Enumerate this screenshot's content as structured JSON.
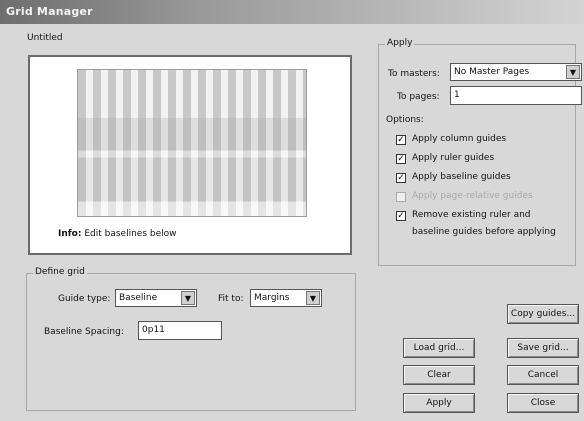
{
  "window": {
    "title": "Grid Manager"
  },
  "preview": {
    "document_label": "Untitled",
    "info_bold": "Info:",
    "info_text": " Edit baselines below"
  },
  "define_grid": {
    "group_title": "Define grid",
    "guide_type_label": "Guide type:",
    "guide_type_value": "Baseline",
    "fit_to_label": "Fit to:",
    "fit_to_value": "Margins",
    "baseline_spacing_label": "Baseline Spacing:",
    "baseline_spacing_value": "0p11"
  },
  "apply": {
    "group_title": "Apply",
    "to_masters_label": "To masters:",
    "to_masters_value": "No Master Pages",
    "to_pages_label": "To pages:",
    "to_pages_value": "1",
    "options_label": "Options:",
    "options": [
      {
        "label": "Apply column guides",
        "checked": true,
        "enabled": true
      },
      {
        "label": "Apply ruler guides",
        "checked": true,
        "enabled": true
      },
      {
        "label": "Apply baseline guides",
        "checked": true,
        "enabled": true
      },
      {
        "label": "Apply page-relative guides",
        "checked": false,
        "enabled": false
      },
      {
        "label": "Remove existing ruler and baseline guides before applying",
        "checked": true,
        "enabled": true
      }
    ]
  },
  "buttons": {
    "copy_guides": "Copy guides...",
    "load_grid": "Load grid...",
    "save_grid": "Save grid...",
    "clear": "Clear",
    "cancel": "Cancel",
    "apply": "Apply",
    "close": "Close"
  }
}
